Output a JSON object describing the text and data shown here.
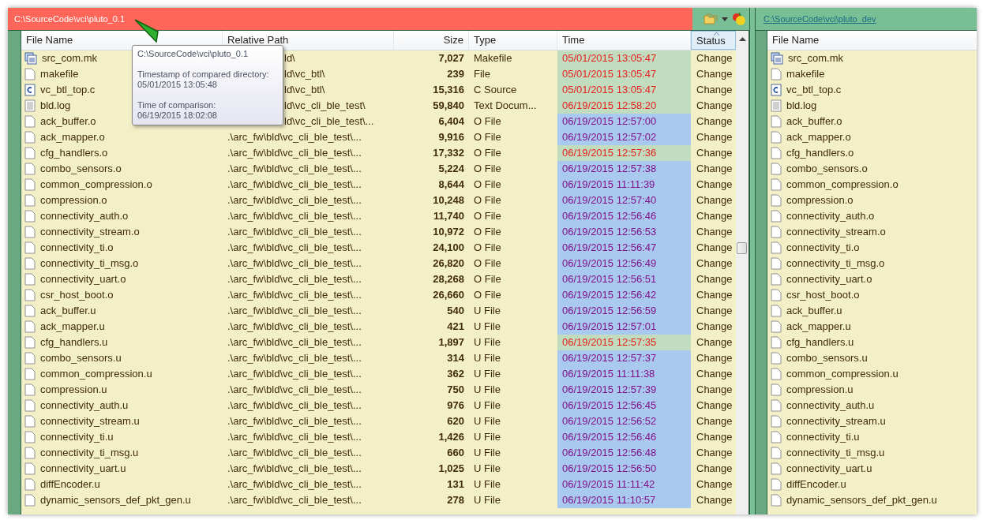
{
  "left_pane": {
    "path": "C:\\SourceCode\\vci\\pluto_0.1",
    "columns": [
      {
        "label": "File Name",
        "sorted": false
      },
      {
        "label": "Relative Path",
        "sorted": false
      },
      {
        "label": "Size",
        "sorted": false
      },
      {
        "label": "Type",
        "sorted": false
      },
      {
        "label": "Time",
        "sorted": false
      },
      {
        "label": "Status",
        "sorted": true
      }
    ],
    "rows": [
      {
        "kind": "mk",
        "name": "src_com.mk",
        "path": "ld\\",
        "size": "7,027",
        "type": "Makefile",
        "time": "05/01/2015 13:05:47",
        "newer": true,
        "status": "Change"
      },
      {
        "kind": "plain",
        "name": "makefile",
        "path": "ld\\vc_btl\\",
        "size": "239",
        "type": "File",
        "time": "05/01/2015 13:05:47",
        "newer": true,
        "status": "Change"
      },
      {
        "kind": "c",
        "name": "vc_btl_top.c",
        "path": "ld\\vc_btl\\",
        "size": "15,316",
        "type": "C Source",
        "time": "05/01/2015 13:05:47",
        "newer": true,
        "status": "Change"
      },
      {
        "kind": "text",
        "name": "bld.log",
        "path": "ld\\vc_cli_ble_test\\",
        "size": "59,840",
        "type": "Text Docum...",
        "time": "06/19/2015 12:58:20",
        "newer": true,
        "status": "Change"
      },
      {
        "kind": "plain",
        "name": "ack_buffer.o",
        "path": "ld\\vc_cli_ble_test\\...",
        "size": "6,404",
        "type": "O File",
        "time": "06/19/2015 12:57:00",
        "newer": false,
        "status": "Change"
      },
      {
        "kind": "plain",
        "name": "ack_mapper.o",
        "path": ".\\arc_fw\\bld\\vc_cli_ble_test\\...",
        "size": "9,916",
        "type": "O File",
        "time": "06/19/2015 12:57:02",
        "newer": false,
        "status": "Change"
      },
      {
        "kind": "plain",
        "name": "cfg_handlers.o",
        "path": ".\\arc_fw\\bld\\vc_cli_ble_test\\...",
        "size": "17,332",
        "type": "O File",
        "time": "06/19/2015 12:57:36",
        "newer": true,
        "status": "Change"
      },
      {
        "kind": "plain",
        "name": "combo_sensors.o",
        "path": ".\\arc_fw\\bld\\vc_cli_ble_test\\...",
        "size": "5,224",
        "type": "O File",
        "time": "06/19/2015 12:57:38",
        "newer": false,
        "status": "Change"
      },
      {
        "kind": "plain",
        "name": "common_compression.o",
        "path": ".\\arc_fw\\bld\\vc_cli_ble_test\\...",
        "size": "8,644",
        "type": "O File",
        "time": "06/19/2015 11:11:39",
        "newer": false,
        "status": "Change"
      },
      {
        "kind": "plain",
        "name": "compression.o",
        "path": ".\\arc_fw\\bld\\vc_cli_ble_test\\...",
        "size": "10,248",
        "type": "O File",
        "time": "06/19/2015 12:57:40",
        "newer": false,
        "status": "Change"
      },
      {
        "kind": "plain",
        "name": "connectivity_auth.o",
        "path": ".\\arc_fw\\bld\\vc_cli_ble_test\\...",
        "size": "11,740",
        "type": "O File",
        "time": "06/19/2015 12:56:46",
        "newer": false,
        "status": "Change"
      },
      {
        "kind": "plain",
        "name": "connectivity_stream.o",
        "path": ".\\arc_fw\\bld\\vc_cli_ble_test\\...",
        "size": "10,972",
        "type": "O File",
        "time": "06/19/2015 12:56:53",
        "newer": false,
        "status": "Change"
      },
      {
        "kind": "plain",
        "name": "connectivity_ti.o",
        "path": ".\\arc_fw\\bld\\vc_cli_ble_test\\...",
        "size": "24,100",
        "type": "O File",
        "time": "06/19/2015 12:56:47",
        "newer": false,
        "status": "Change"
      },
      {
        "kind": "plain",
        "name": "connectivity_ti_msg.o",
        "path": ".\\arc_fw\\bld\\vc_cli_ble_test\\...",
        "size": "26,820",
        "type": "O File",
        "time": "06/19/2015 12:56:49",
        "newer": false,
        "status": "Change"
      },
      {
        "kind": "plain",
        "name": "connectivity_uart.o",
        "path": ".\\arc_fw\\bld\\vc_cli_ble_test\\...",
        "size": "28,268",
        "type": "O File",
        "time": "06/19/2015 12:56:51",
        "newer": false,
        "status": "Change"
      },
      {
        "kind": "plain",
        "name": "csr_host_boot.o",
        "path": ".\\arc_fw\\bld\\vc_cli_ble_test\\...",
        "size": "26,660",
        "type": "O File",
        "time": "06/19/2015 12:56:42",
        "newer": false,
        "status": "Change"
      },
      {
        "kind": "plain",
        "name": "ack_buffer.u",
        "path": ".\\arc_fw\\bld\\vc_cli_ble_test\\...",
        "size": "540",
        "type": "U File",
        "time": "06/19/2015 12:56:59",
        "newer": false,
        "status": "Change"
      },
      {
        "kind": "plain",
        "name": "ack_mapper.u",
        "path": ".\\arc_fw\\bld\\vc_cli_ble_test\\...",
        "size": "421",
        "type": "U File",
        "time": "06/19/2015 12:57:01",
        "newer": false,
        "status": "Change"
      },
      {
        "kind": "plain",
        "name": "cfg_handlers.u",
        "path": ".\\arc_fw\\bld\\vc_cli_ble_test\\...",
        "size": "1,897",
        "type": "U File",
        "time": "06/19/2015 12:57:35",
        "newer": true,
        "status": "Change"
      },
      {
        "kind": "plain",
        "name": "combo_sensors.u",
        "path": ".\\arc_fw\\bld\\vc_cli_ble_test\\...",
        "size": "314",
        "type": "U File",
        "time": "06/19/2015 12:57:37",
        "newer": false,
        "status": "Change"
      },
      {
        "kind": "plain",
        "name": "common_compression.u",
        "path": ".\\arc_fw\\bld\\vc_cli_ble_test\\...",
        "size": "362",
        "type": "U File",
        "time": "06/19/2015 11:11:38",
        "newer": false,
        "status": "Change"
      },
      {
        "kind": "plain",
        "name": "compression.u",
        "path": ".\\arc_fw\\bld\\vc_cli_ble_test\\...",
        "size": "750",
        "type": "U File",
        "time": "06/19/2015 12:57:39",
        "newer": false,
        "status": "Change"
      },
      {
        "kind": "plain",
        "name": "connectivity_auth.u",
        "path": ".\\arc_fw\\bld\\vc_cli_ble_test\\...",
        "size": "976",
        "type": "U File",
        "time": "06/19/2015 12:56:45",
        "newer": false,
        "status": "Change"
      },
      {
        "kind": "plain",
        "name": "connectivity_stream.u",
        "path": ".\\arc_fw\\bld\\vc_cli_ble_test\\...",
        "size": "620",
        "type": "U File",
        "time": "06/19/2015 12:56:52",
        "newer": false,
        "status": "Change"
      },
      {
        "kind": "plain",
        "name": "connectivity_ti.u",
        "path": ".\\arc_fw\\bld\\vc_cli_ble_test\\...",
        "size": "1,426",
        "type": "U File",
        "time": "06/19/2015 12:56:46",
        "newer": false,
        "status": "Change"
      },
      {
        "kind": "plain",
        "name": "connectivity_ti_msg.u",
        "path": ".\\arc_fw\\bld\\vc_cli_ble_test\\...",
        "size": "660",
        "type": "U File",
        "time": "06/19/2015 12:56:48",
        "newer": false,
        "status": "Change"
      },
      {
        "kind": "plain",
        "name": "connectivity_uart.u",
        "path": ".\\arc_fw\\bld\\vc_cli_ble_test\\...",
        "size": "1,025",
        "type": "U File",
        "time": "06/19/2015 12:56:50",
        "newer": false,
        "status": "Change"
      },
      {
        "kind": "plain",
        "name": "diffEncoder.u",
        "path": ".\\arc_fw\\bld\\vc_cli_ble_test\\...",
        "size": "131",
        "type": "U File",
        "time": "06/19/2015 11:11:42",
        "newer": false,
        "status": "Change"
      },
      {
        "kind": "plain",
        "name": "dynamic_sensors_def_pkt_gen.u",
        "path": ".\\arc_fw\\bld\\vc_cli_ble_test\\...",
        "size": "278",
        "type": "U File",
        "time": "06/19/2015 11:10:57",
        "newer": false,
        "status": "Change"
      }
    ]
  },
  "tooltip": {
    "path": "C:\\SourceCode\\vci\\pluto_0.1",
    "timestamp_label": "Timestamp of compared directory:",
    "timestamp": "05/01/2015 13:05:48",
    "comparison_label": "Time of comparison:",
    "comparison_time": "06/19/2015 18:02:08"
  },
  "right_pane": {
    "path": "C:\\SourceCode\\vci\\pluto_dev",
    "column": "File Name",
    "rows": [
      {
        "kind": "mk",
        "name": "src_com.mk"
      },
      {
        "kind": "plain",
        "name": "makefile"
      },
      {
        "kind": "c",
        "name": "vc_btl_top.c"
      },
      {
        "kind": "text",
        "name": "bld.log"
      },
      {
        "kind": "plain",
        "name": "ack_buffer.o"
      },
      {
        "kind": "plain",
        "name": "ack_mapper.o"
      },
      {
        "kind": "plain",
        "name": "cfg_handlers.o"
      },
      {
        "kind": "plain",
        "name": "combo_sensors.o"
      },
      {
        "kind": "plain",
        "name": "common_compression.o"
      },
      {
        "kind": "plain",
        "name": "compression.o"
      },
      {
        "kind": "plain",
        "name": "connectivity_auth.o"
      },
      {
        "kind": "plain",
        "name": "connectivity_stream.o"
      },
      {
        "kind": "plain",
        "name": "connectivity_ti.o"
      },
      {
        "kind": "plain",
        "name": "connectivity_ti_msg.o"
      },
      {
        "kind": "plain",
        "name": "connectivity_uart.o"
      },
      {
        "kind": "plain",
        "name": "csr_host_boot.o"
      },
      {
        "kind": "plain",
        "name": "ack_buffer.u"
      },
      {
        "kind": "plain",
        "name": "ack_mapper.u"
      },
      {
        "kind": "plain",
        "name": "cfg_handlers.u"
      },
      {
        "kind": "plain",
        "name": "combo_sensors.u"
      },
      {
        "kind": "plain",
        "name": "common_compression.u"
      },
      {
        "kind": "plain",
        "name": "compression.u"
      },
      {
        "kind": "plain",
        "name": "connectivity_auth.u"
      },
      {
        "kind": "plain",
        "name": "connectivity_stream.u"
      },
      {
        "kind": "plain",
        "name": "connectivity_ti.u"
      },
      {
        "kind": "plain",
        "name": "connectivity_ti_msg.u"
      },
      {
        "kind": "plain",
        "name": "connectivity_uart.u"
      },
      {
        "kind": "plain",
        "name": "diffEncoder.u"
      },
      {
        "kind": "plain",
        "name": "dynamic_sensors_def_pkt_gen.u"
      }
    ]
  }
}
